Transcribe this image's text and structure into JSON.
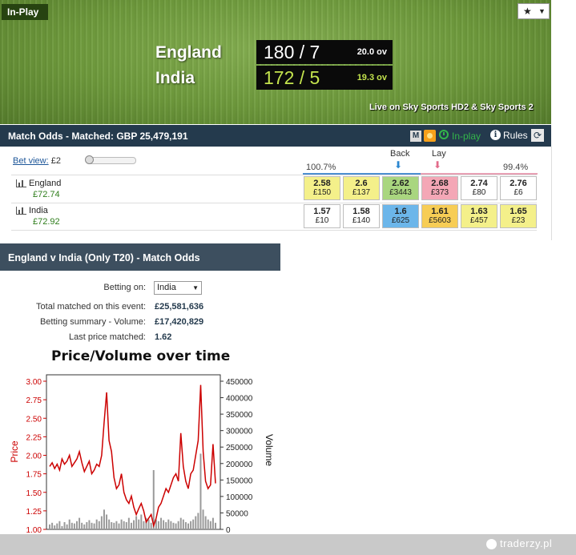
{
  "header": {
    "inplay_label": "In-Play",
    "fav_icon": "star-icon",
    "live_text": "Live on Sky Sports HD2 & Sky Sports 2",
    "teams": [
      {
        "name": "England",
        "score": "180 / 7",
        "overs": "20.0 ov",
        "score_color": "#ffffff"
      },
      {
        "name": "India",
        "score": "172 / 5",
        "overs": "19.3 ov",
        "score_color": "#c3e34d"
      }
    ]
  },
  "match_odds": {
    "title": "Match Odds - Matched: GBP 25,479,191",
    "m_label": "M",
    "inplay_label": "In-play",
    "rules_label": "Rules",
    "bet_view_label": "Bet view:",
    "bet_view_value": "£2",
    "overround_back": "100.7%",
    "overround_lay": "99.4%",
    "back_label": "Back",
    "lay_label": "Lay",
    "runners": [
      {
        "name": "England",
        "pl": "£72.74",
        "cells": [
          {
            "price": "2.58",
            "size": "£150",
            "color": "yellow"
          },
          {
            "price": "2.6",
            "size": "£137",
            "color": "yellow"
          },
          {
            "price": "2.62",
            "size": "£3443",
            "color": "green"
          },
          {
            "price": "2.68",
            "size": "£373",
            "color": "pink"
          },
          {
            "price": "2.74",
            "size": "£80",
            "color": "white"
          },
          {
            "price": "2.76",
            "size": "£6",
            "color": "white"
          }
        ]
      },
      {
        "name": "India",
        "pl": "£72.92",
        "cells": [
          {
            "price": "1.57",
            "size": "£10",
            "color": "white"
          },
          {
            "price": "1.58",
            "size": "£140",
            "color": "white"
          },
          {
            "price": "1.6",
            "size": "£625",
            "color": "blue"
          },
          {
            "price": "1.61",
            "size": "£5603",
            "color": "orange"
          },
          {
            "price": "1.63",
            "size": "£457",
            "color": "yellow"
          },
          {
            "price": "1.65",
            "size": "£23",
            "color": "yellow"
          }
        ]
      }
    ]
  },
  "event": {
    "title": "England v India (Only T20) - Match Odds",
    "betting_on_label": "Betting on:",
    "betting_on_value": "India",
    "total_matched_label": "Total matched on this event:",
    "total_matched_value": "£25,581,636",
    "summary_label": "Betting summary - Volume:",
    "summary_value": "£17,420,829",
    "last_price_label": "Last price matched:",
    "last_price_value": "1.62"
  },
  "chart_data": {
    "type": "line",
    "title": "Price/Volume over time",
    "ylabel": "Price",
    "y2label": "Volume",
    "ylim": [
      1.0,
      3.0
    ],
    "y2lim": [
      0,
      450000
    ],
    "yticks": [
      "1.00",
      "1.25",
      "1.50",
      "1.75",
      "2.00",
      "2.25",
      "2.50",
      "2.75",
      "3.00"
    ],
    "y2ticks": [
      "0",
      "50000",
      "100000",
      "150000",
      "200000",
      "250000",
      "300000",
      "350000",
      "400000",
      "450000"
    ],
    "price_color": "#cc0000",
    "volume_color": "#9a9a9a",
    "series": [
      {
        "name": "Price",
        "values": [
          1.85,
          1.9,
          1.82,
          1.88,
          1.8,
          1.95,
          1.88,
          1.92,
          2.0,
          1.85,
          1.9,
          1.95,
          2.05,
          1.9,
          1.78,
          1.85,
          1.92,
          1.75,
          1.8,
          1.88,
          1.85,
          2.0,
          2.45,
          2.85,
          2.2,
          2.05,
          1.7,
          1.55,
          1.6,
          1.75,
          1.5,
          1.4,
          1.35,
          1.45,
          1.3,
          1.2,
          1.28,
          1.35,
          1.25,
          1.1,
          1.15,
          1.2,
          1.05,
          1.15,
          1.3,
          1.35,
          1.45,
          1.55,
          1.5,
          1.6,
          1.7,
          1.75,
          1.65,
          2.3,
          1.85,
          1.65,
          1.55,
          1.75,
          1.8,
          2.0,
          2.2,
          2.95,
          2.05,
          1.65,
          1.55,
          1.6,
          2.15,
          1.62
        ]
      },
      {
        "name": "Volume",
        "values": [
          15000,
          20000,
          12000,
          18000,
          25000,
          10000,
          22000,
          15000,
          30000,
          20000,
          18000,
          25000,
          35000,
          20000,
          15000,
          22000,
          28000,
          20000,
          18000,
          30000,
          25000,
          40000,
          60000,
          45000,
          30000,
          22000,
          20000,
          25000,
          18000,
          30000,
          25000,
          22000,
          35000,
          20000,
          28000,
          40000,
          30000,
          45000,
          25000,
          35000,
          30000,
          20000,
          180000,
          30000,
          25000,
          35000,
          28000,
          22000,
          30000,
          25000,
          20000,
          18000,
          25000,
          35000,
          30000,
          22000,
          18000,
          25000,
          30000,
          40000,
          50000,
          230000,
          60000,
          40000,
          30000,
          25000,
          35000,
          20000
        ]
      }
    ]
  },
  "footer": {
    "brand": "traderzy.pl"
  }
}
